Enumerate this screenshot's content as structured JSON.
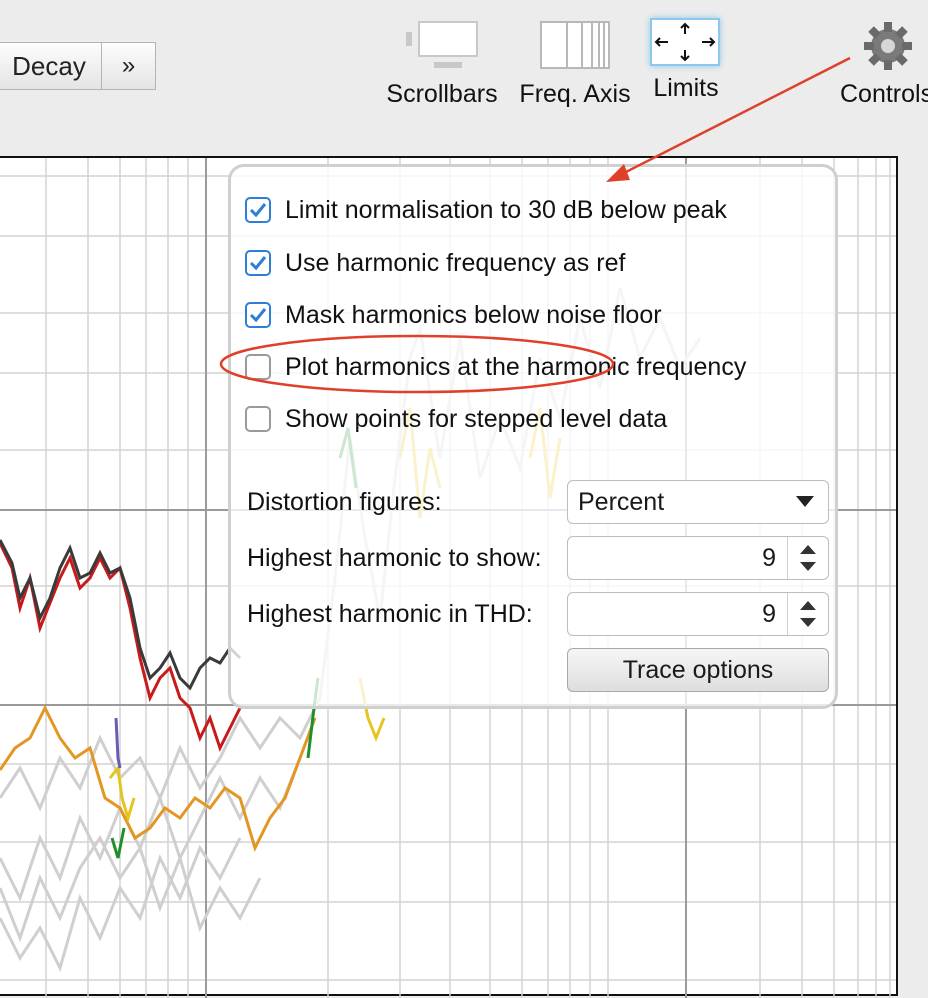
{
  "toolbar": {
    "decay_label": "Decay",
    "more_label": "»",
    "tools": [
      {
        "label": "Scrollbars",
        "icon": "scrollbars-icon"
      },
      {
        "label": "Freq. Axis",
        "icon": "freq-axis-icon"
      },
      {
        "label": "Limits",
        "icon": "limits-icon"
      },
      {
        "label": "Controls",
        "icon": "gear-icon"
      }
    ]
  },
  "panel": {
    "checkboxes": [
      {
        "label": "Limit normalisation to 30 dB below peak",
        "checked": true
      },
      {
        "label": "Use harmonic frequency as ref",
        "checked": true
      },
      {
        "label": "Mask harmonics below noise floor",
        "checked": true
      },
      {
        "label": "Plot harmonics at the harmonic frequency",
        "checked": false
      },
      {
        "label": "Show points for stepped level data",
        "checked": false
      }
    ],
    "distortion_label": "Distortion figures:",
    "distortion_value": "Percent",
    "highest_show_label": "Highest harmonic to show:",
    "highest_show_value": "9",
    "highest_thd_label": "Highest harmonic in THD:",
    "highest_thd_value": "9",
    "trace_options_label": "Trace options"
  },
  "colors": {
    "accent": "#2d7fd6",
    "annotation_red": "#e0402a"
  }
}
